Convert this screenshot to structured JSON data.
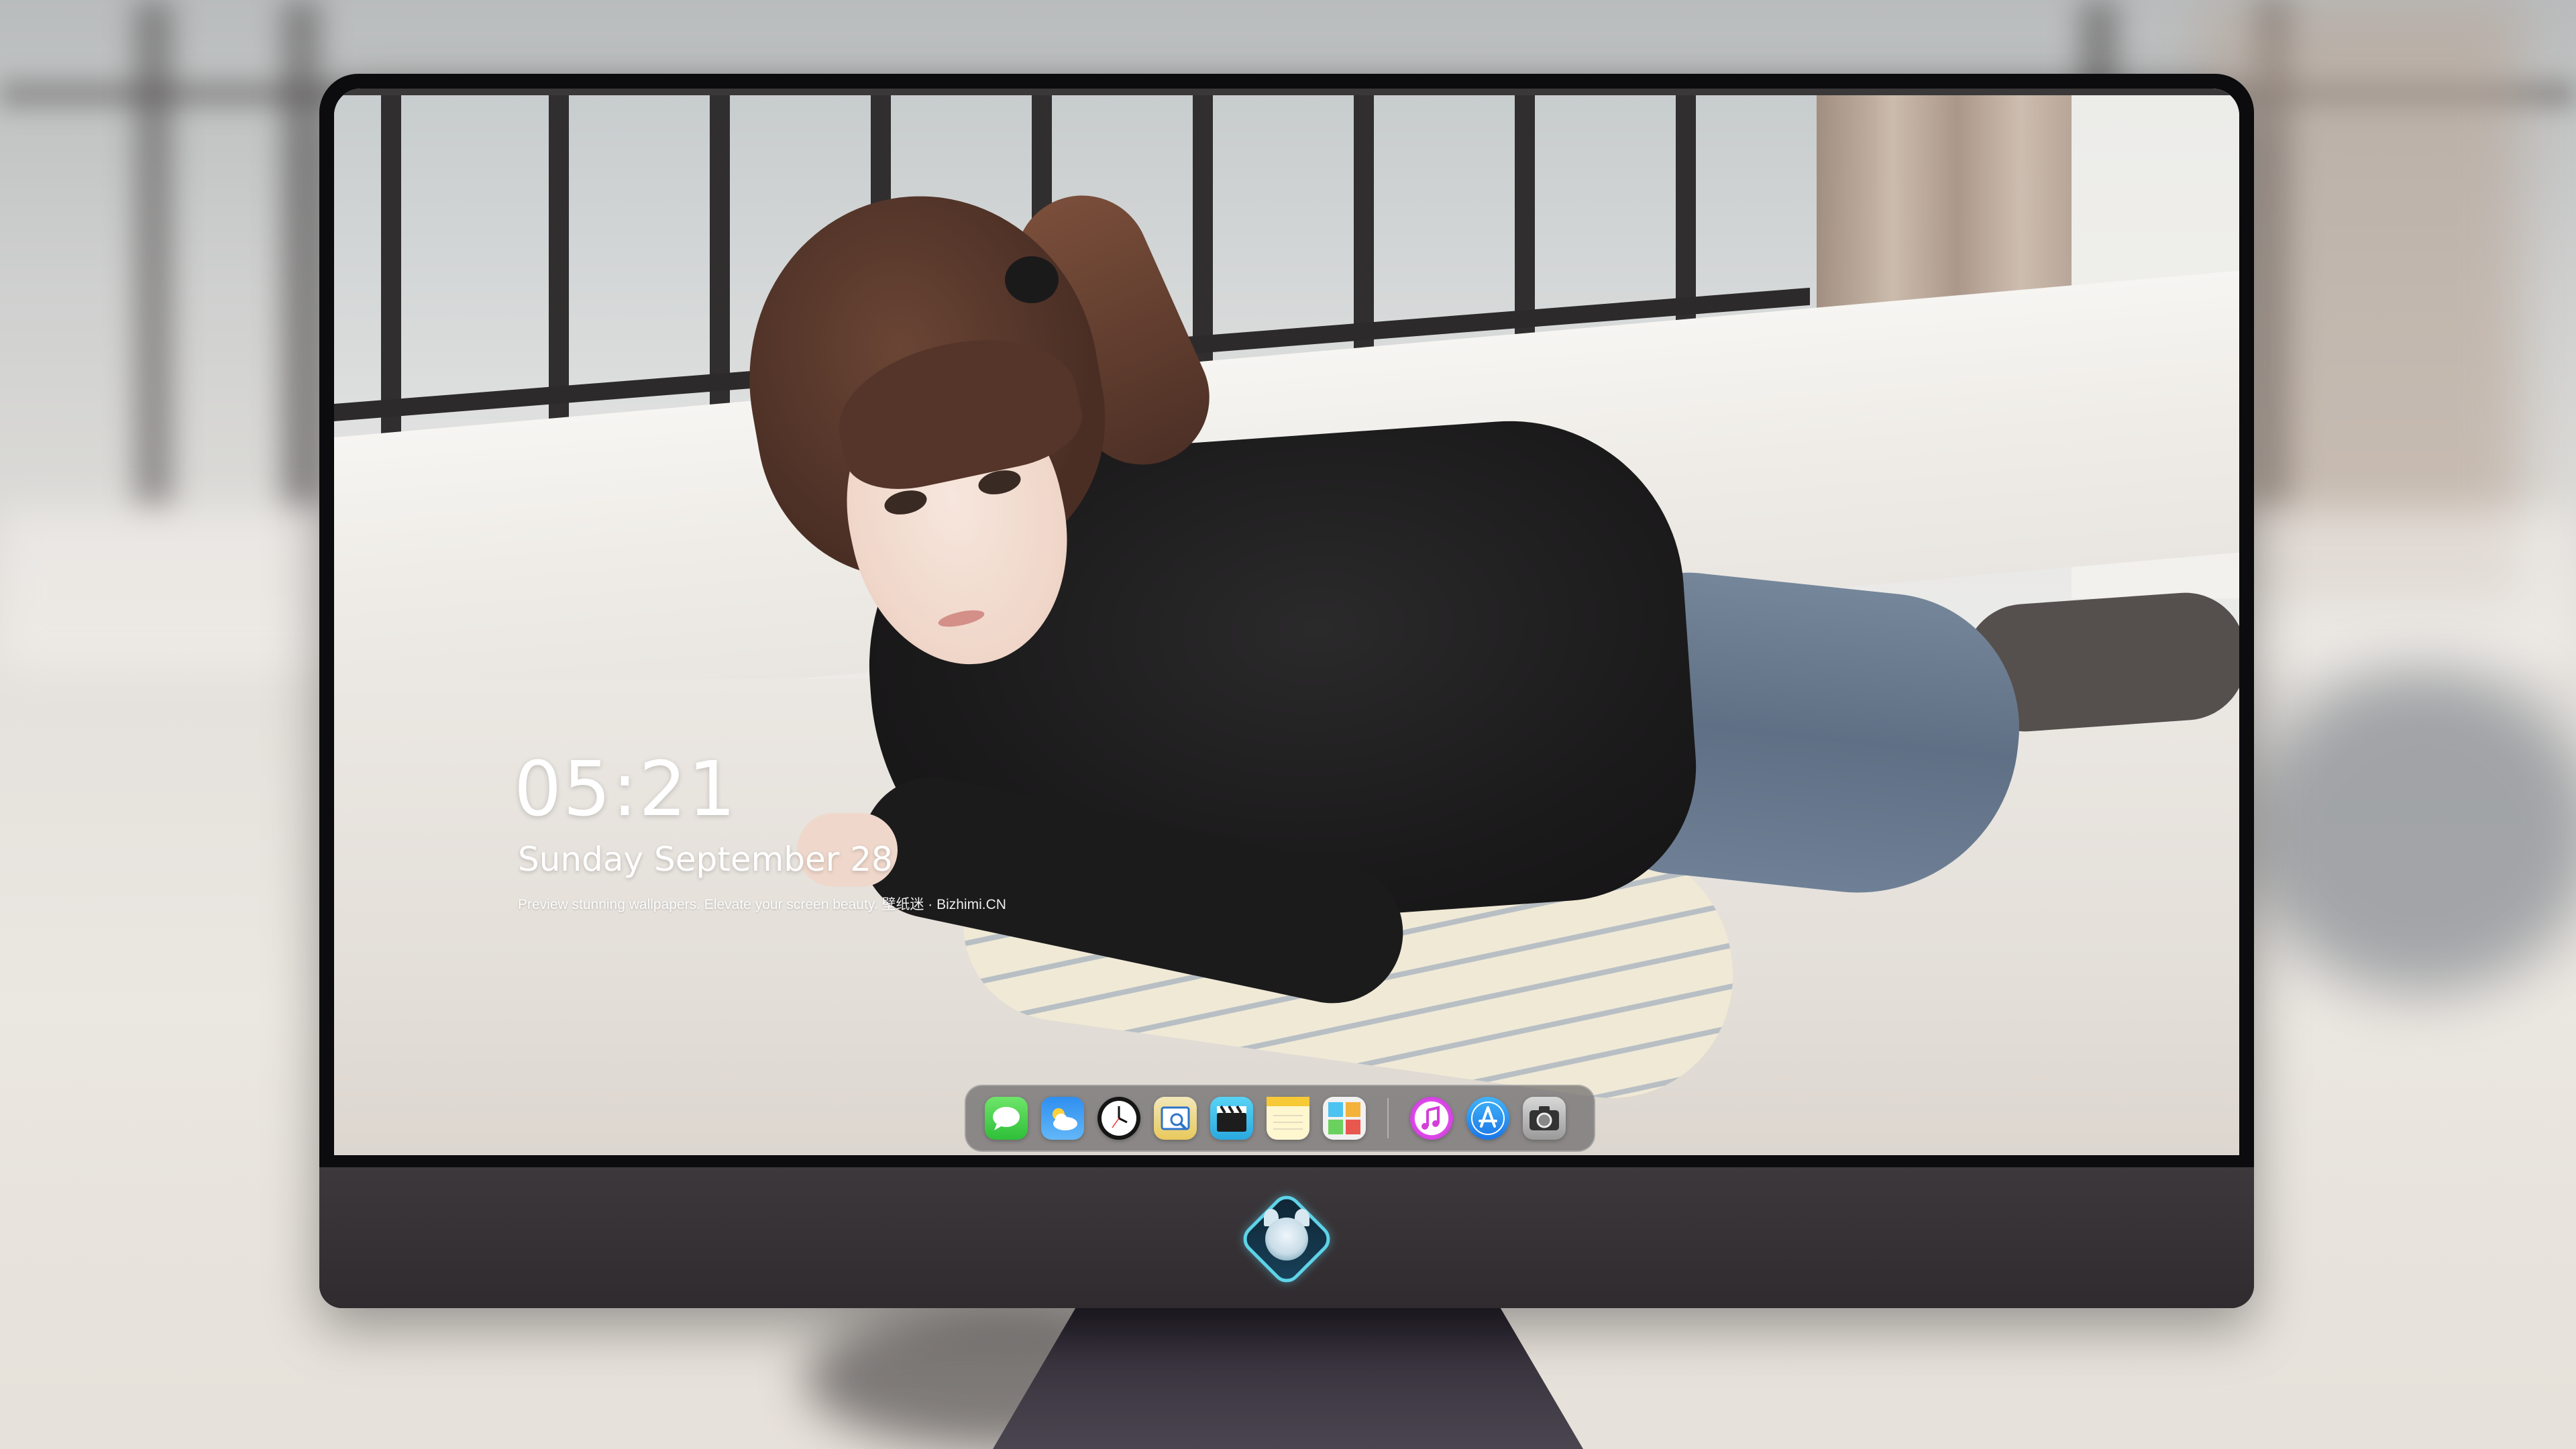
{
  "lockscreen": {
    "time": "05:21",
    "date": "Sunday September 28",
    "tagline": "Preview stunning wallpapers. Elevate your screen beauty. 壁纸迷 · Bizhimi.CN"
  },
  "dock": {
    "apps": [
      {
        "name": "Messages",
        "icon": "messages-icon"
      },
      {
        "name": "Weather",
        "icon": "weather-icon"
      },
      {
        "name": "Clock",
        "icon": "clock-icon"
      },
      {
        "name": "Preview",
        "icon": "preview-icon"
      },
      {
        "name": "Clips",
        "icon": "clips-icon"
      },
      {
        "name": "Notes",
        "icon": "notes-icon"
      },
      {
        "name": "Photo Booth",
        "icon": "photo-booth-icon"
      },
      {
        "name": "iTunes",
        "icon": "itunes-icon"
      },
      {
        "name": "App Store",
        "icon": "app-store-icon"
      },
      {
        "name": "Camera",
        "icon": "camera-icon"
      }
    ]
  },
  "colors": {
    "bezel": "#0c0b0d",
    "chin": "#37323a",
    "logo_accent": "#5ed3e8",
    "text": "#ffffff"
  }
}
